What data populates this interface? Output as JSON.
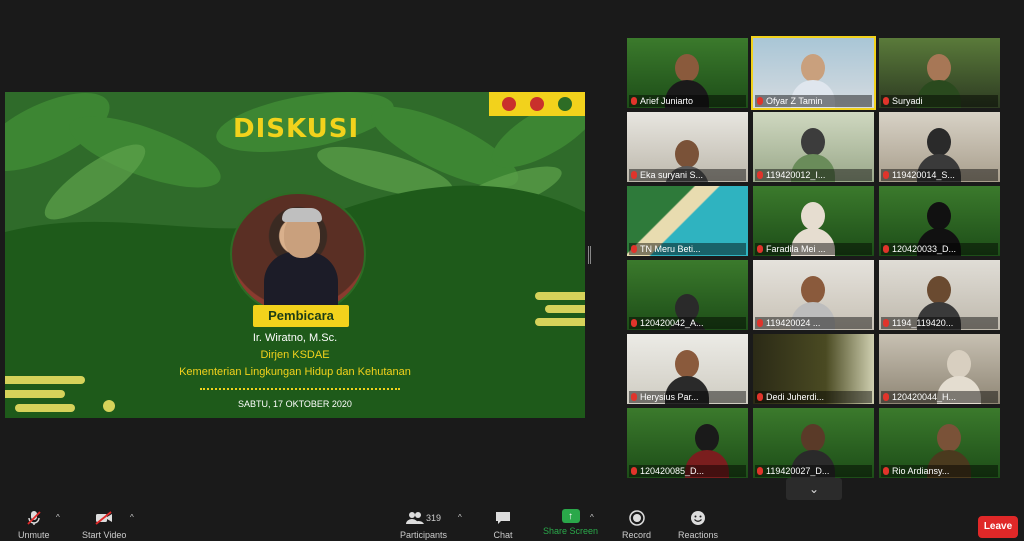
{
  "slide": {
    "title": "DISKUSI",
    "badge": "Pembicara",
    "speaker_name": "Ir. Wiratno, M.Sc.",
    "speaker_title": "Dirjen KSDAE",
    "speaker_org": "Kementerian Lingkungan Hidup dan Kehutanan",
    "date": "SABTU, 17 OKTOBER 2020"
  },
  "gallery": {
    "tiles": [
      {
        "name": "Arief Juniarto"
      },
      {
        "name": "Ofyar Z Tamin"
      },
      {
        "name": "Suryadi"
      },
      {
        "name": "Eka suryani S..."
      },
      {
        "name": "119420012_I..."
      },
      {
        "name": "119420014_S..."
      },
      {
        "name": "TN Meru Beti..."
      },
      {
        "name": "Faradila Mei ..."
      },
      {
        "name": "120420033_D..."
      },
      {
        "name": "120420042_A..."
      },
      {
        "name": "119420024 ..."
      },
      {
        "name": "1194_119420..."
      },
      {
        "name": "Herysius Par..."
      },
      {
        "name": "Dedi Juherdi..."
      },
      {
        "name": "120420044_H..."
      },
      {
        "name": "120420085_D..."
      },
      {
        "name": "119420027_D..."
      },
      {
        "name": "Rio Ardiansy..."
      }
    ],
    "scroll_icon": "chevron-down-icon"
  },
  "toolbar": {
    "unmute": "Unmute",
    "start_video": "Start Video",
    "participants": "Participants",
    "participant_count": "319",
    "chat": "Chat",
    "share_screen": "Share Screen",
    "record": "Record",
    "reactions": "Reactions",
    "leave": "Leave"
  },
  "colors": {
    "accent_yellow": "#f2d21c",
    "slide_green": "#1e5a1a",
    "share_green": "#2aa84a",
    "leave_red": "#e02828"
  }
}
